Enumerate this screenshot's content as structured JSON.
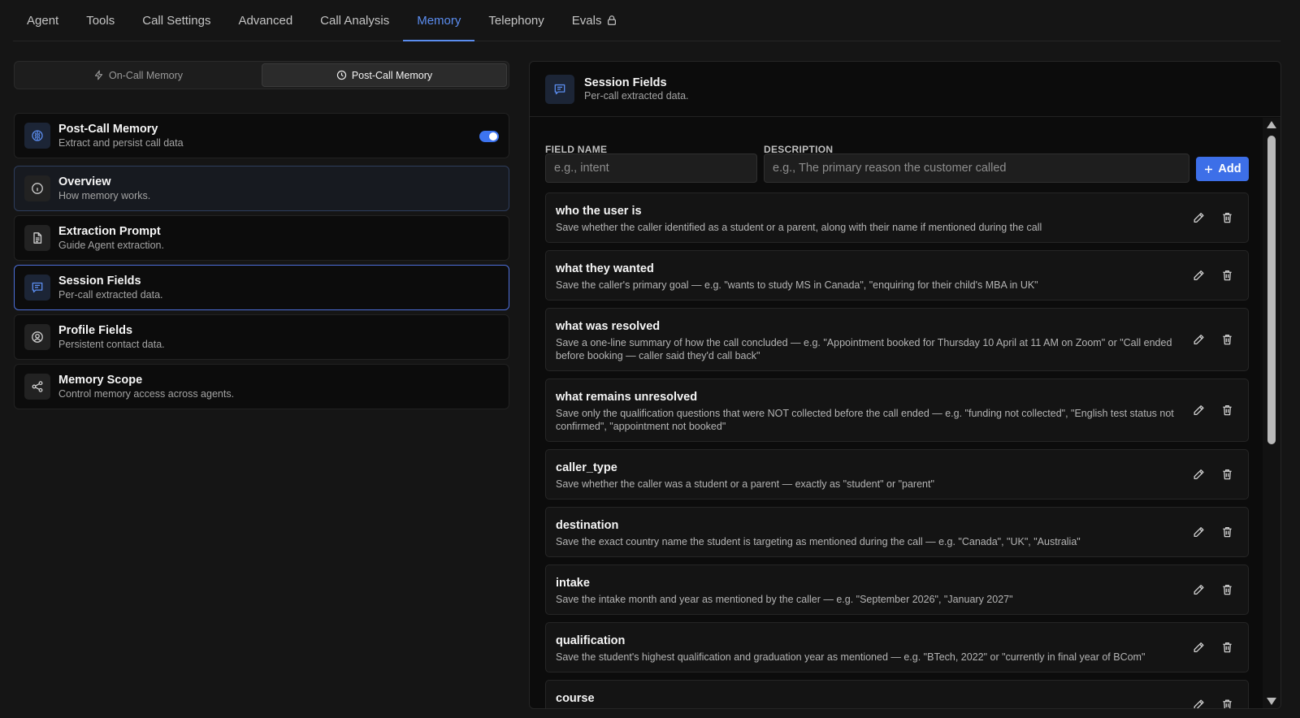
{
  "tabs": [
    {
      "label": "Agent"
    },
    {
      "label": "Tools"
    },
    {
      "label": "Call Settings"
    },
    {
      "label": "Advanced"
    },
    {
      "label": "Call Analysis"
    },
    {
      "label": "Memory"
    },
    {
      "label": "Telephony"
    },
    {
      "label": "Evals"
    }
  ],
  "active_tab": "Memory",
  "segment": {
    "on_call": "On-Call Memory",
    "post_call": "Post-Call Memory",
    "active": "Post-Call Memory"
  },
  "left_cards": [
    {
      "title": "Post-Call Memory",
      "sub": "Extract and persist call data",
      "icon": "brain-icon",
      "toggle_on": true
    },
    {
      "title": "Overview",
      "sub": "How memory works.",
      "icon": "info-icon"
    },
    {
      "title": "Extraction Prompt",
      "sub": "Guide Agent extraction.",
      "icon": "document-icon"
    },
    {
      "title": "Session Fields",
      "sub": "Per-call extracted data.",
      "icon": "message-icon"
    },
    {
      "title": "Profile Fields",
      "sub": "Persistent contact data.",
      "icon": "user-circle-icon"
    },
    {
      "title": "Memory Scope",
      "sub": "Control memory access across agents.",
      "icon": "share-icon"
    }
  ],
  "panel": {
    "title": "Session Fields",
    "sub": "Per-call extracted data.",
    "field_name_label": "FIELD NAME",
    "description_label": "DESCRIPTION",
    "field_name_placeholder": "e.g., intent",
    "description_placeholder": "e.g., The primary reason the customer called",
    "add_label": "Add"
  },
  "fields": [
    {
      "name": "who the user is",
      "desc": "Save whether the caller identified as a student or a parent, along with their name if mentioned during the call"
    },
    {
      "name": "what they wanted",
      "desc": "Save the caller's primary goal — e.g. \"wants to study MS in Canada\", \"enquiring for their child's MBA in UK\""
    },
    {
      "name": "what was resolved",
      "desc": "Save a one-line summary of how the call concluded — e.g. \"Appointment booked for Thursday 10 April at 11 AM on Zoom\" or \"Call ended before booking — caller said they'd call back\""
    },
    {
      "name": "what remains unresolved",
      "desc": "Save only the qualification questions that were NOT collected before the call ended — e.g. \"funding not collected\", \"English test status not confirmed\", \"appointment not booked\""
    },
    {
      "name": "caller_type",
      "desc": "Save whether the caller was a student or a parent — exactly as \"student\" or \"parent\""
    },
    {
      "name": "destination",
      "desc": "Save the exact country name the student is targeting as mentioned during the call — e.g. \"Canada\", \"UK\", \"Australia\""
    },
    {
      "name": "intake",
      "desc": "Save the intake month and year as mentioned by the caller — e.g. \"September 2026\", \"January 2027\""
    },
    {
      "name": "qualification",
      "desc": "Save the student's highest qualification and graduation year as mentioned — e.g. \"BTech, 2022\" or \"currently in final year of BCom\""
    },
    {
      "name": "course",
      "desc": ""
    }
  ],
  "colors": {
    "accent": "#5b8def",
    "toggle": "#3d74f0",
    "add_button": "#3d6fe8"
  }
}
